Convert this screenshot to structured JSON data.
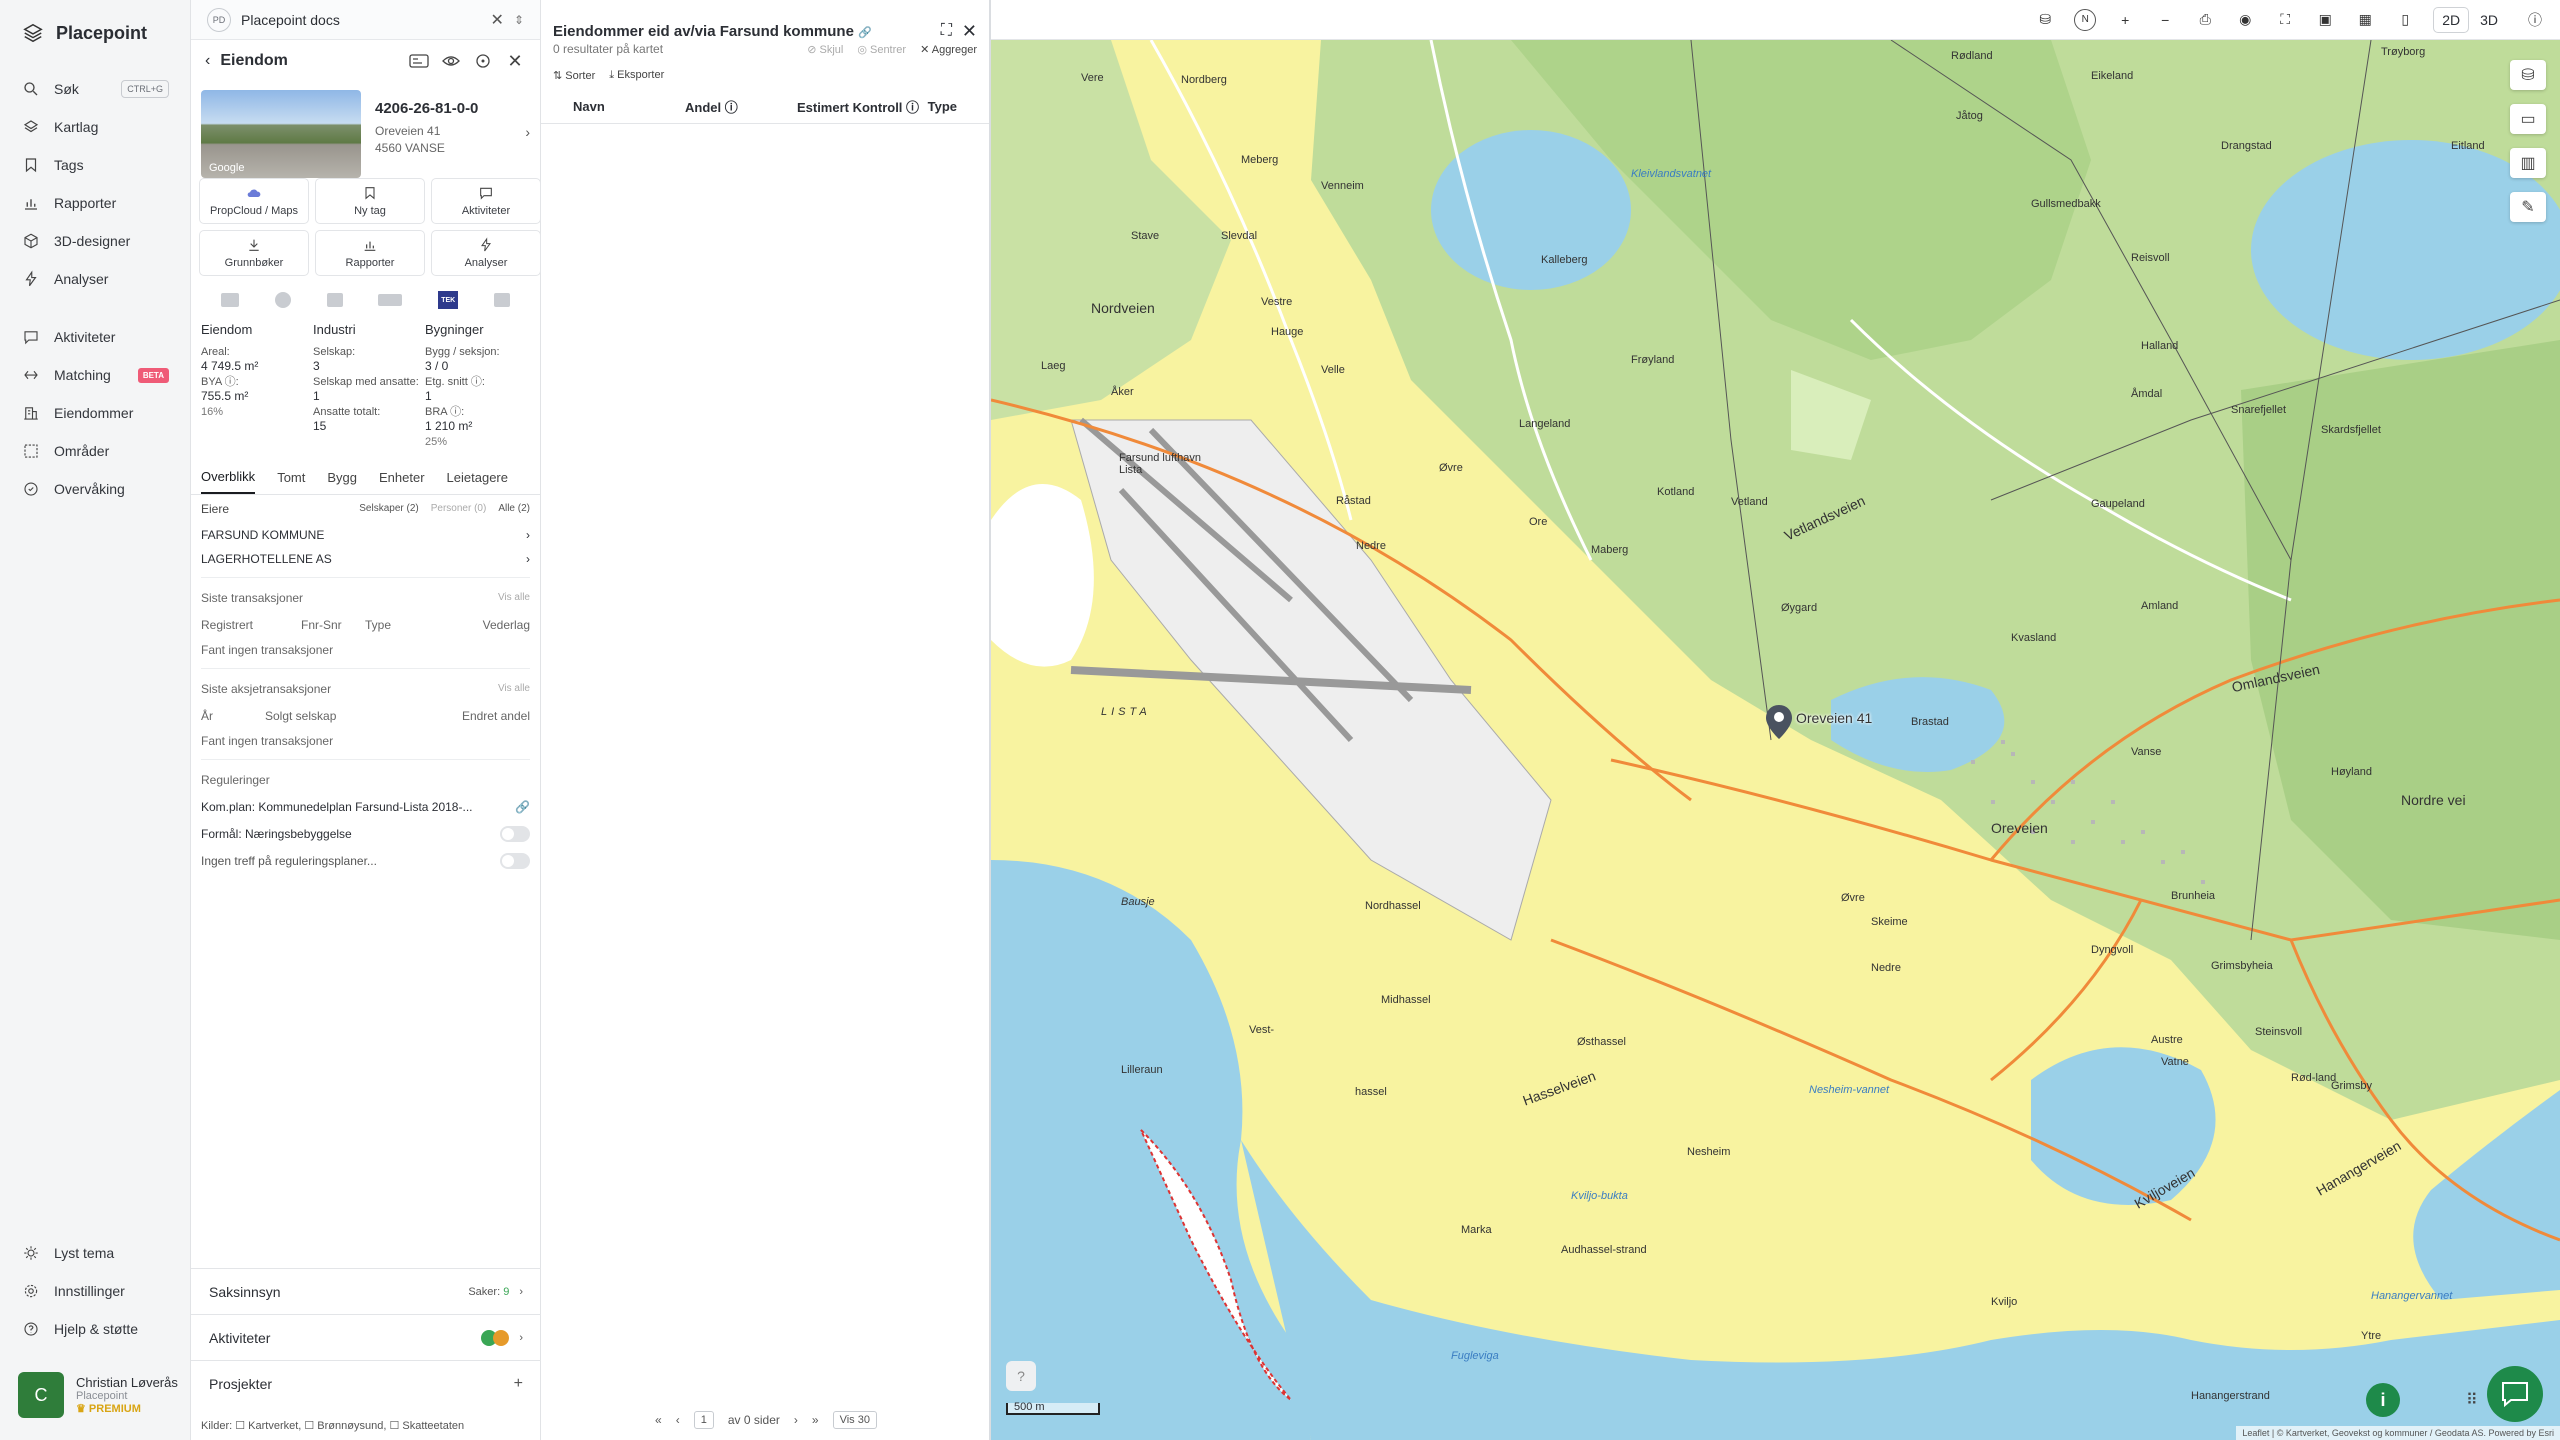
{
  "nav": {
    "brand": "Placepoint",
    "items": [
      {
        "label": "Søk",
        "icon": "search-icon",
        "shortcut": "CTRL+G"
      },
      {
        "label": "Kartlag",
        "icon": "layers-icon"
      },
      {
        "label": "Tags",
        "icon": "bookmark-icon"
      },
      {
        "label": "Rapporter",
        "icon": "chart-icon"
      },
      {
        "label": "3D-designer",
        "icon": "cube-icon"
      },
      {
        "label": "Analyser",
        "icon": "bolt-icon"
      }
    ],
    "items2": [
      {
        "label": "Aktiviteter",
        "icon": "chat-icon"
      },
      {
        "label": "Matching",
        "icon": "matching-icon",
        "badge": "BETA"
      },
      {
        "label": "Eiendommer",
        "icon": "building-icon"
      },
      {
        "label": "Områder",
        "icon": "area-icon"
      },
      {
        "label": "Overvåking",
        "icon": "monitor-icon"
      }
    ],
    "bottom": [
      {
        "label": "Lyst tema",
        "icon": "sun-icon"
      },
      {
        "label": "Innstillinger",
        "icon": "gear-icon"
      },
      {
        "label": "Hjelp & støtte",
        "icon": "help-icon"
      }
    ],
    "user": {
      "initial": "C",
      "name": "Christian Løverås",
      "org": "Placepoint",
      "plan": "PREMIUM"
    }
  },
  "doc": {
    "badge": "PD",
    "title": "Placepoint docs"
  },
  "property": {
    "header": "Eiendom",
    "id": "4206-26-81-0-0",
    "street": "Oreveien 41",
    "city": "4560 VANSE",
    "img_label": "Google",
    "tiles": [
      {
        "label": "PropCloud / Maps",
        "icon": "cloud-icon"
      },
      {
        "label": "Ny tag",
        "icon": "bookmark-icon"
      },
      {
        "label": "Aktiviteter",
        "icon": "chat-icon"
      },
      {
        "label": "Grunnbøker",
        "icon": "download-icon"
      },
      {
        "label": "Rapporter",
        "icon": "chart-icon"
      },
      {
        "label": "Analyser",
        "icon": "bolt-icon"
      }
    ],
    "tek": "TEK",
    "facts": {
      "eiendom_h": "Eiendom",
      "areal_l": "Areal:",
      "areal_v": "4 749.5 m²",
      "bya_l": "BYA ⓘ:",
      "bya_v": "755.5 m²",
      "bya_p": "16%",
      "industri_h": "Industri",
      "selskap_l": "Selskap:",
      "selskap_v": "3",
      "ansatte_l": "Selskap med ansatte:",
      "ansatte_v": "1",
      "tot_l": "Ansatte totalt:",
      "tot_v": "15",
      "bygg_h": "Bygninger",
      "bs_l": "Bygg / seksjon:",
      "bs_v": "3 / 0",
      "etg_l": "Etg. snitt ⓘ:",
      "etg_v": "1",
      "bra_l": "BRA ⓘ:",
      "bra_v": "1 210 m²",
      "bra_p": "25%"
    },
    "tabs": [
      "Overblikk",
      "Tomt",
      "Bygg",
      "Enheter",
      "Leietagere"
    ],
    "owners": {
      "label": "Eiere",
      "f1": "Selskaper (2)",
      "f2": "Personer (0)",
      "f3": "Alle (2)",
      "list": [
        "FARSUND KOMMUNE",
        "LAGERHOTELLENE AS"
      ]
    },
    "tx": {
      "title": "Siste transaksjoner",
      "vis": "Vis alle",
      "c1": "Registrert",
      "c2": "Fnr-Snr",
      "c3": "Type",
      "c4": "Vederlag",
      "empty": "Fant ingen transaksjoner"
    },
    "stx": {
      "title": "Siste aksjetransaksjoner",
      "vis": "Vis alle",
      "c1": "År",
      "c2": "Solgt selskap",
      "c3": "Endret andel",
      "empty": "Fant ingen transaksjoner"
    },
    "reg": {
      "title": "Reguleringer",
      "plan": "Kom.plan: Kommunedelplan Farsund-Lista 2018-...",
      "formal": "Formål: Næringsbebyggelse",
      "none": "Ingen treff på reguleringsplaner..."
    },
    "bottom": {
      "saks": "Saksinnsyn",
      "saker_l": "Saker:",
      "saker_v": "9",
      "akt": "Aktiviteter",
      "prosj": "Prosjekter"
    },
    "sources": "Kilder: ☐ Kartverket, ☐ Brønnøysund, ☐ Skatteetaten"
  },
  "results": {
    "title": "Eiendommer eid av/via Farsund kommune",
    "count": "0 resultater på kartet",
    "skjul": "Skjul",
    "sentrer": "Sentrer",
    "aggreger": "Aggreger",
    "sorter": "Sorter",
    "eksporter": "Eksporter",
    "cols": [
      "Navn",
      "Andel ⓘ",
      "Estimert Kontroll ⓘ",
      "Type"
    ],
    "pager": {
      "page": "1",
      "of": "av 0 sider",
      "per": "Vis 30"
    }
  },
  "map": {
    "marker": "Oreveien 41",
    "scale": "500 m",
    "attribution": "Leaflet | © Kartverket, Geovekst og kommuner / Geodata AS. Powered by Esri",
    "labels": [
      "Vere",
      "Nordberg",
      "Rødland",
      "Eikeland",
      "Jåtog",
      "Trøyborg",
      "Meberg",
      "Venneim",
      "Kleivlandsvatnet",
      "Gullsmedbakk",
      "Drangstad",
      "Eitland",
      "Stave",
      "Slevdal",
      "Reisvoll",
      "Halland",
      "Kalleberg",
      "Vestre",
      "Hauge",
      "Nordveien",
      "Laeg",
      "Åker",
      "Frøyland",
      "Åmdal",
      "Snarefjellet",
      "Skardsfjellet",
      "Velle",
      "Langeland",
      "Farsund lufthavn Lista",
      "Råstad",
      "Øvre",
      "Ore",
      "Kotland",
      "Vetland",
      "Gaupeland",
      "Nedre",
      "Maberg",
      "Vetlandsveien",
      "Øygard",
      "Kvasland",
      "Amland",
      "Omlandsveien",
      "LISTA",
      "Brastad",
      "Vanse",
      "Høyland",
      "Nordre vei",
      "Oreveien",
      "Bausje",
      "Nordhassel",
      "Øvre",
      "Skeime",
      "Brunheia",
      "Nedre",
      "Dyngvoll",
      "Grimsbyheia",
      "Midhassel",
      "Vest-",
      "Austre",
      "Steinsvoll",
      "Lilleraun",
      "hassel",
      "Østhassel",
      "Vatne",
      "Rød-land",
      "Grimsby",
      "Hasselveien",
      "Nesheim",
      "Nesheim-vannet",
      "Hanangerveien",
      "Kviljoveien",
      "Kviljo-bukta",
      "Marka",
      "Audhassel-strand",
      "Kviljo",
      "Fugleviga",
      "Hanangervannet",
      "Hanangerstrand",
      "Ytre"
    ]
  },
  "topbar": {
    "mode2d": "2D",
    "mode3d": "3D",
    "n": "N"
  }
}
